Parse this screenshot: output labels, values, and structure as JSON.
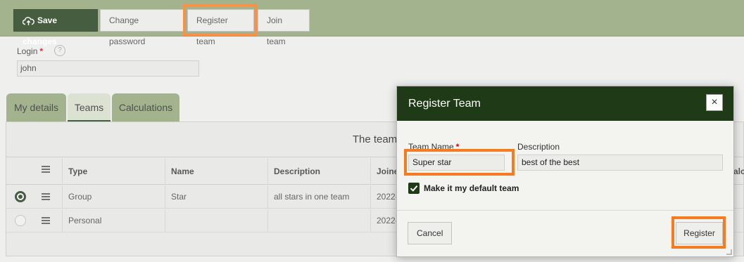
{
  "toolbar": {
    "save_label": "Save changes",
    "change_password_label": "Change password",
    "register_team_label": "Register team",
    "join_team_label": "Join team"
  },
  "login": {
    "label": "Login",
    "required_mark": "*",
    "help": "?",
    "value": "john"
  },
  "tabs": [
    {
      "label": "My details"
    },
    {
      "label": "Teams"
    },
    {
      "label": "Calculations"
    }
  ],
  "teams": {
    "title": "The team",
    "columns": [
      "Type",
      "Name",
      "Description",
      "Joine",
      "alc"
    ],
    "rows": [
      {
        "type": "Group",
        "name": "Star",
        "description": "all stars in one team",
        "joined": "2022-",
        "selected": true
      },
      {
        "type": "Personal",
        "name": "",
        "description": "",
        "joined": "2022-",
        "selected": false
      }
    ]
  },
  "dialog": {
    "title": "Register Team",
    "close": "×",
    "team_name_label": "Team Name",
    "required_mark": "*",
    "team_name_value": "Super star",
    "description_label": "Description",
    "description_value": "best of the best",
    "default_team_label": "Make it my default team",
    "default_team_checked": true,
    "cancel_label": "Cancel",
    "register_label": "Register"
  },
  "colors": {
    "toolbar_bg": "#8ea374",
    "dark_green": "#1f3a16",
    "highlight": "#f57c22"
  }
}
